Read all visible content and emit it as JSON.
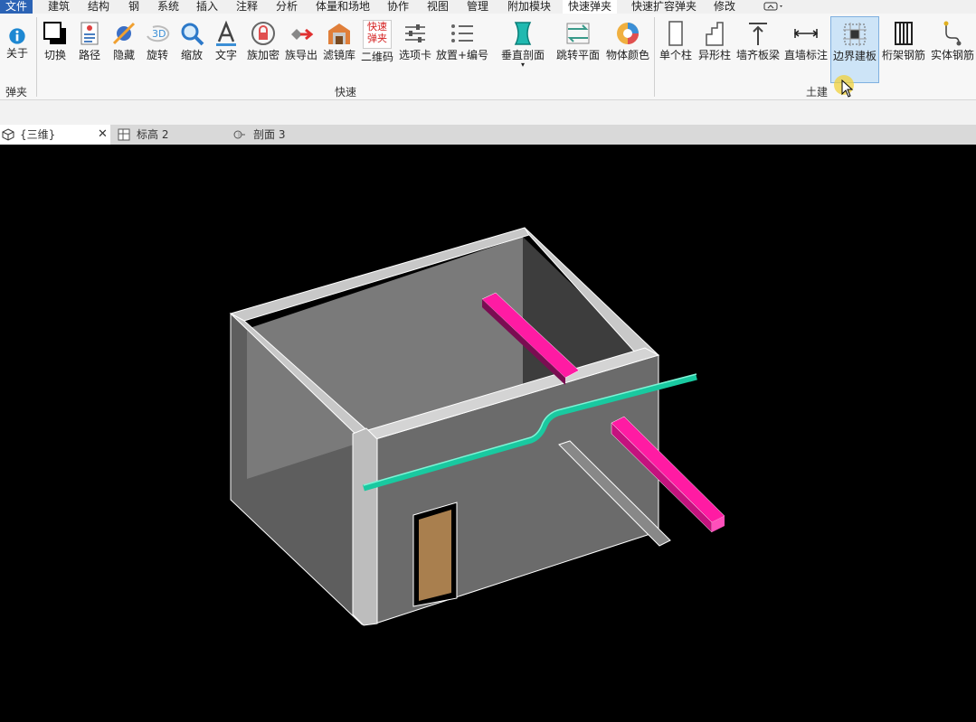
{
  "menu": {
    "file": "文件",
    "items": [
      "建筑",
      "结构",
      "钢",
      "系统",
      "插入",
      "注释",
      "分析",
      "体量和场地",
      "协作",
      "视图",
      "管理",
      "附加模块",
      "快速弹夹",
      "快速扩容弹夹",
      "修改"
    ],
    "active": "快速弹夹"
  },
  "ribbon": {
    "groups": {
      "left": "弹夹",
      "quick": "快速",
      "civil": "土建"
    },
    "buttons": {
      "about": "关于",
      "switch": "切换",
      "path": "路径",
      "hide": "隐藏",
      "rotate": "旋转",
      "zoom": "缩放",
      "text": "文字",
      "family_encrypt": "族加密",
      "family_export": "族导出",
      "filter_lib": "滤镜库",
      "qrcode": "二维码",
      "options_card": "选项卡",
      "place_number": "放置+编号",
      "vertical_section": "垂直剖面",
      "jump_plane": "跳转平面",
      "object_color": "物体颜色",
      "single_column": "单个柱",
      "special_column": "异形柱",
      "wall_beam": "墙齐板梁",
      "straight_wall_dim": "直墙标注",
      "boundary_slab": "边界建板",
      "truss_rebar": "桁架钢筋",
      "solid_rebar": "实体钢筋"
    },
    "qr_icon_text": [
      "快速",
      "弹夹"
    ],
    "rotate_icon_text": "3D"
  },
  "tabs": [
    {
      "label": "{三维}",
      "close": "✕"
    },
    {
      "label": "标高 2"
    },
    {
      "label": "剖面 3"
    }
  ],
  "colors": {
    "accent": "#2b63b5",
    "pipe": "#19c9a0",
    "beam": "#ff1ba3",
    "door": "#a97f4e"
  }
}
